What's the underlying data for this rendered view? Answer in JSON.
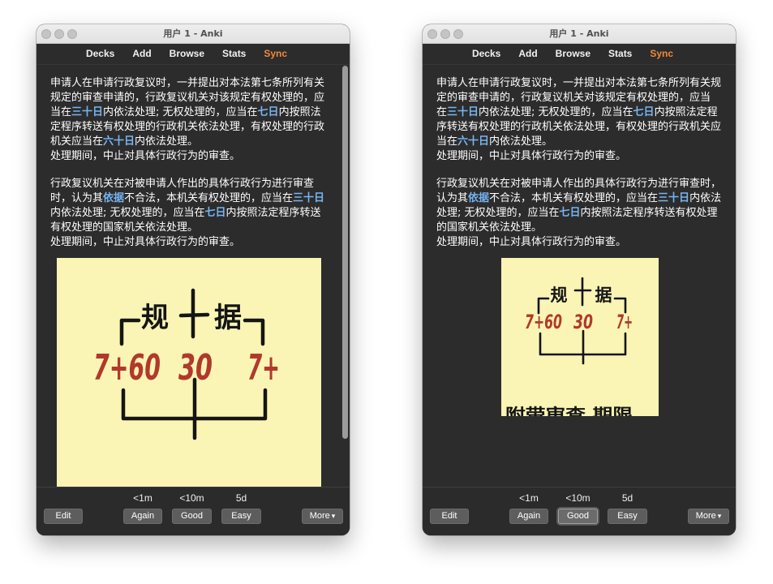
{
  "colors": {
    "sync_accent": "#f0893c",
    "highlight": "#76b5f1",
    "sticky_note": "#faf5b4",
    "ink": "#151515",
    "red_ink": "#b2382c"
  },
  "left": {
    "title": "用户 1 - Anki",
    "toolbar": {
      "decks": "Decks",
      "add": "Add",
      "browse": "Browse",
      "stats": "Stats",
      "sync": "Sync"
    },
    "card": {
      "paragraphs": [
        {
          "lines": [
            [
              "申请人在申请行政复议时，一并提出对本法第七条所列有关"
            ],
            [
              "规定的审查申请的，行政复议机关对该规定有权处理的，应"
            ],
            [
              "当在",
              {
                "text": "三十日"
              },
              "内依法处理; 无权处理的，应当在",
              {
                "text": "七日"
              },
              "内按照法"
            ],
            [
              "定程序转送有权处理的行政机关依法处理，有权处理的行政"
            ],
            [
              "机关应当在",
              {
                "text": "六十日"
              },
              "内依法处理。"
            ],
            [
              "处理期间，中止对具体行政行为的审查。"
            ]
          ]
        },
        {
          "lines": [
            [
              "行政复议机关在对被申请人作出的具体行政行为进行审查"
            ],
            [
              "时，认为其",
              {
                "text": "依据"
              },
              "不合法，本机关有权处理的，应当在",
              {
                "text": "三十日"
              }
            ],
            [
              "内依法处理; 无权处理的，应当在",
              {
                "text": "七日"
              },
              "内按照法定程序转送"
            ],
            [
              "有权处理的国家机关依法处理。"
            ],
            [
              "处理期间，中止对具体行政行为的审查。"
            ]
          ]
        }
      ],
      "image": {
        "labels": {
          "gui": "规",
          "ju": "据",
          "left": "7+60",
          "mid": "30",
          "right": "7+"
        }
      }
    },
    "answer": {
      "edit": "Edit",
      "buttons": [
        {
          "label": "Again",
          "interval": "<1m"
        },
        {
          "label": "Good",
          "interval": "<10m"
        },
        {
          "label": "Easy",
          "interval": "5d"
        }
      ],
      "more": "More",
      "more_icon": "caret-down-icon",
      "good_focused": false
    }
  },
  "right": {
    "title": "用户 1 - Anki",
    "toolbar": {
      "decks": "Decks",
      "add": "Add",
      "browse": "Browse",
      "stats": "Stats",
      "sync": "Sync"
    },
    "card": {
      "paragraphs": [
        {
          "lines": [
            [
              "申请人在申请行政复议时，一并提出对本法第七条所列有关规"
            ],
            [
              "定的审查申请的，行政复议机关对该规定有权处理的，应当"
            ],
            [
              "在",
              {
                "text": "三十日"
              },
              "内依法处理; 无权处理的，应当在",
              {
                "text": "七日"
              },
              "内按照法定程"
            ],
            [
              "序转送有权处理的行政机关依法处理，有权处理的行政机关应"
            ],
            [
              "当在",
              {
                "text": "六十日"
              },
              "内依法处理。"
            ],
            [
              "处理期间，中止对具体行政行为的审查。"
            ]
          ]
        },
        {
          "lines": [
            [
              "行政复议机关在对被申请人作出的具体行政行为进行审查时，"
            ],
            [
              "认为其",
              {
                "text": "依据"
              },
              "不合法，本机关有权处理的，应当在",
              {
                "text": "三十日"
              },
              "内依法"
            ],
            [
              "处理; 无权处理的，应当在",
              {
                "text": "七日"
              },
              "内按照法定程序转送有权处理"
            ],
            [
              "的国家机关依法处理。"
            ],
            [
              "处理期间，中止对具体行政行为的审查。"
            ]
          ]
        }
      ],
      "image": {
        "labels": {
          "gui": "规",
          "ju": "据",
          "left": "7+60",
          "mid": "30",
          "right": "7+",
          "caption": "附带审查 期限"
        }
      }
    },
    "answer": {
      "edit": "Edit",
      "buttons": [
        {
          "label": "Again",
          "interval": "<1m"
        },
        {
          "label": "Good",
          "interval": "<10m"
        },
        {
          "label": "Easy",
          "interval": "5d"
        }
      ],
      "more": "More",
      "more_icon": "caret-down-icon",
      "good_focused": true
    }
  }
}
